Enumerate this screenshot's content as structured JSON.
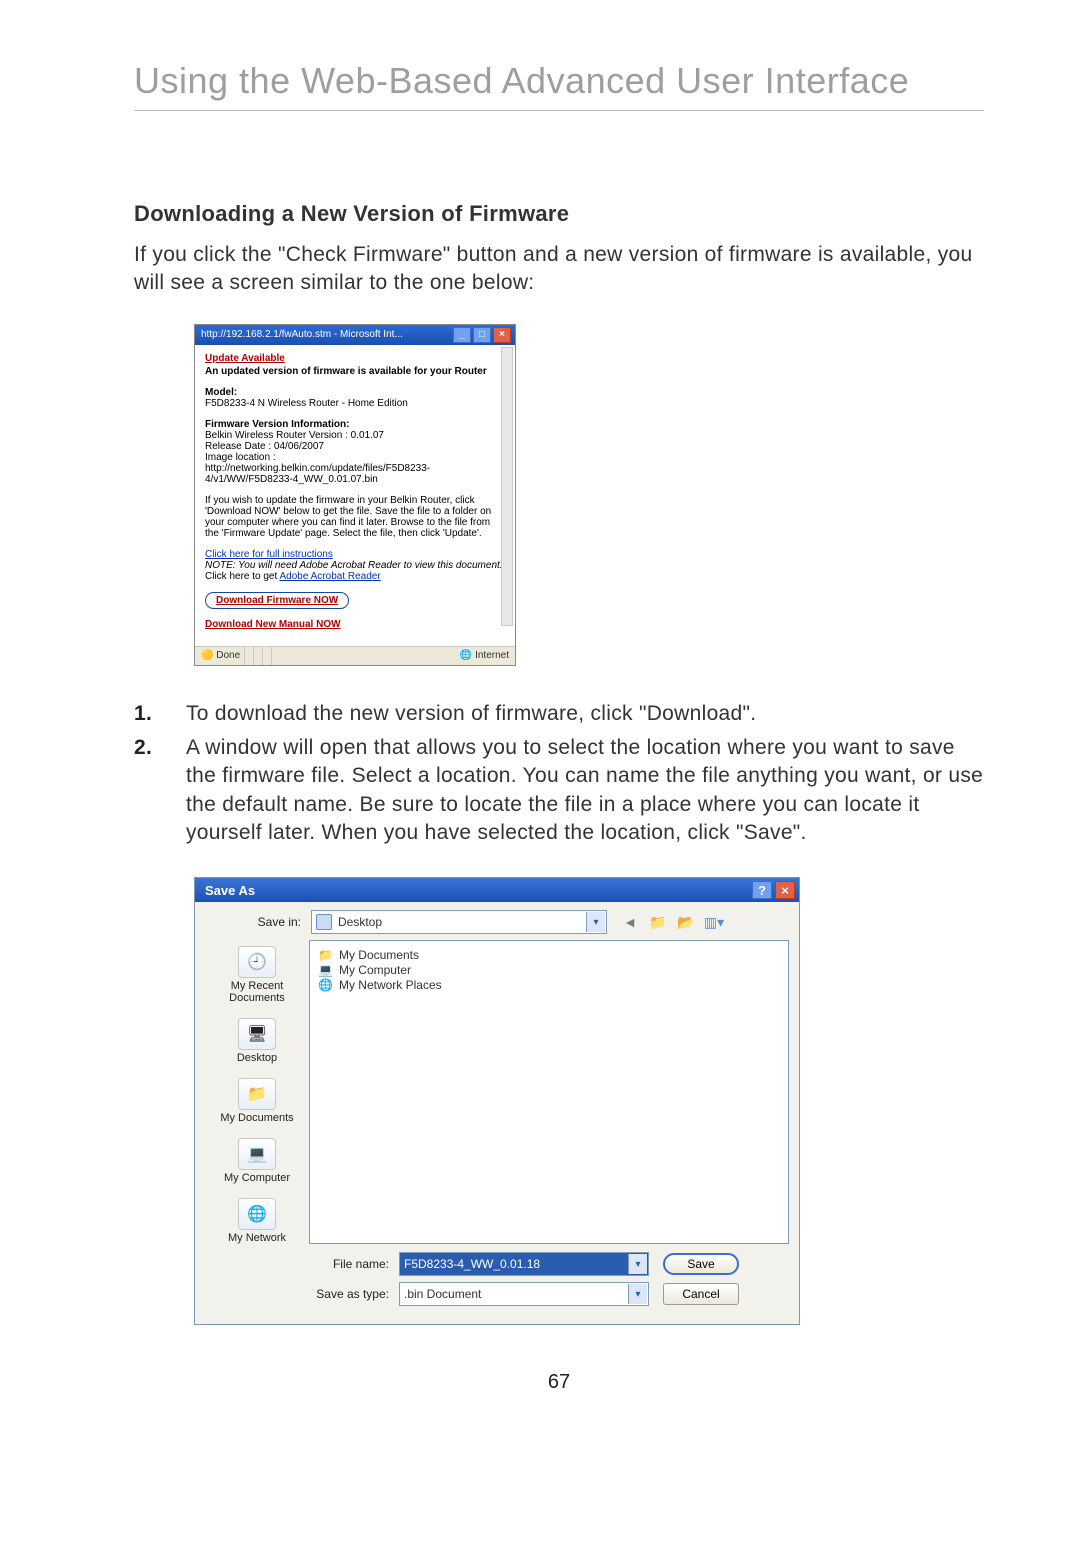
{
  "page": {
    "title": "Using the Web-Based Advanced User Interface",
    "number": "67"
  },
  "section": {
    "heading": "Downloading a New Version of Firmware",
    "intro": "If you click the \"Check Firmware\" button and a new version of firmware is available, you will see a screen similar to the one below:"
  },
  "ie_popup": {
    "titlebar": "http://192.168.2.1/fwAuto.stm - Microsoft Int...",
    "update_heading": "Update Available",
    "update_line": "An updated version of firmware is available for your Router",
    "model_label": "Model:",
    "model_value": "F5D8233-4 N Wireless Router - Home Edition",
    "fvinfo_label": "Firmware Version Information:",
    "fv_version": "Belkin Wireless Router Version : 0.01.07",
    "fv_release": "Release Date : 04/06/2007",
    "fv_imgloc_label": "Image location :",
    "fv_imgloc_value": "http://networking.belkin.com/update/files/F5D8233-4/v1/WW/F5D8233-4_WW_0.01.07.bin",
    "instructions": "If you wish to update the firmware in your Belkin Router, click 'Download NOW' below to get the file. Save the file to a folder on your computer where you can find it later. Browse to the file from the 'Firmware Update' page. Select the file, then click 'Update'.",
    "full_instructions_link": "Click here for full instructions",
    "note_prefix": "NOTE: You will need Adobe Acrobat Reader to view this document.",
    "note_link_prefix": " Click here to get ",
    "adobe_link": "Adobe Acrobat Reader",
    "download_fw_btn": "Download Firmware NOW",
    "download_manual_link": "Download New Manual NOW",
    "status_done": "Done",
    "status_zone": "Internet"
  },
  "steps": [
    "To download the new version of firmware, click \"Download\".",
    "A window will open that allows you to select the location where you want to save the firmware file. Select a location. You can name the file anything you want, or use the default name. Be sure to locate the file in a place where you can locate it yourself later. When you have selected the location, click \"Save\"."
  ],
  "saveas": {
    "title": "Save As",
    "savein_label": "Save in:",
    "savein_value": "Desktop",
    "places": {
      "recent": "My Recent Documents",
      "desktop": "Desktop",
      "mydocs": "My Documents",
      "mycomp": "My Computer",
      "mynet": "My Network"
    },
    "listing": {
      "mydocs": "My Documents",
      "mycomp": "My Computer",
      "mynet": "My Network Places"
    },
    "filename_label": "File name:",
    "filename_value": "F5D8233-4_WW_0.01.18",
    "savetype_label": "Save as type:",
    "savetype_value": ".bin Document",
    "save_btn": "Save",
    "cancel_btn": "Cancel"
  }
}
